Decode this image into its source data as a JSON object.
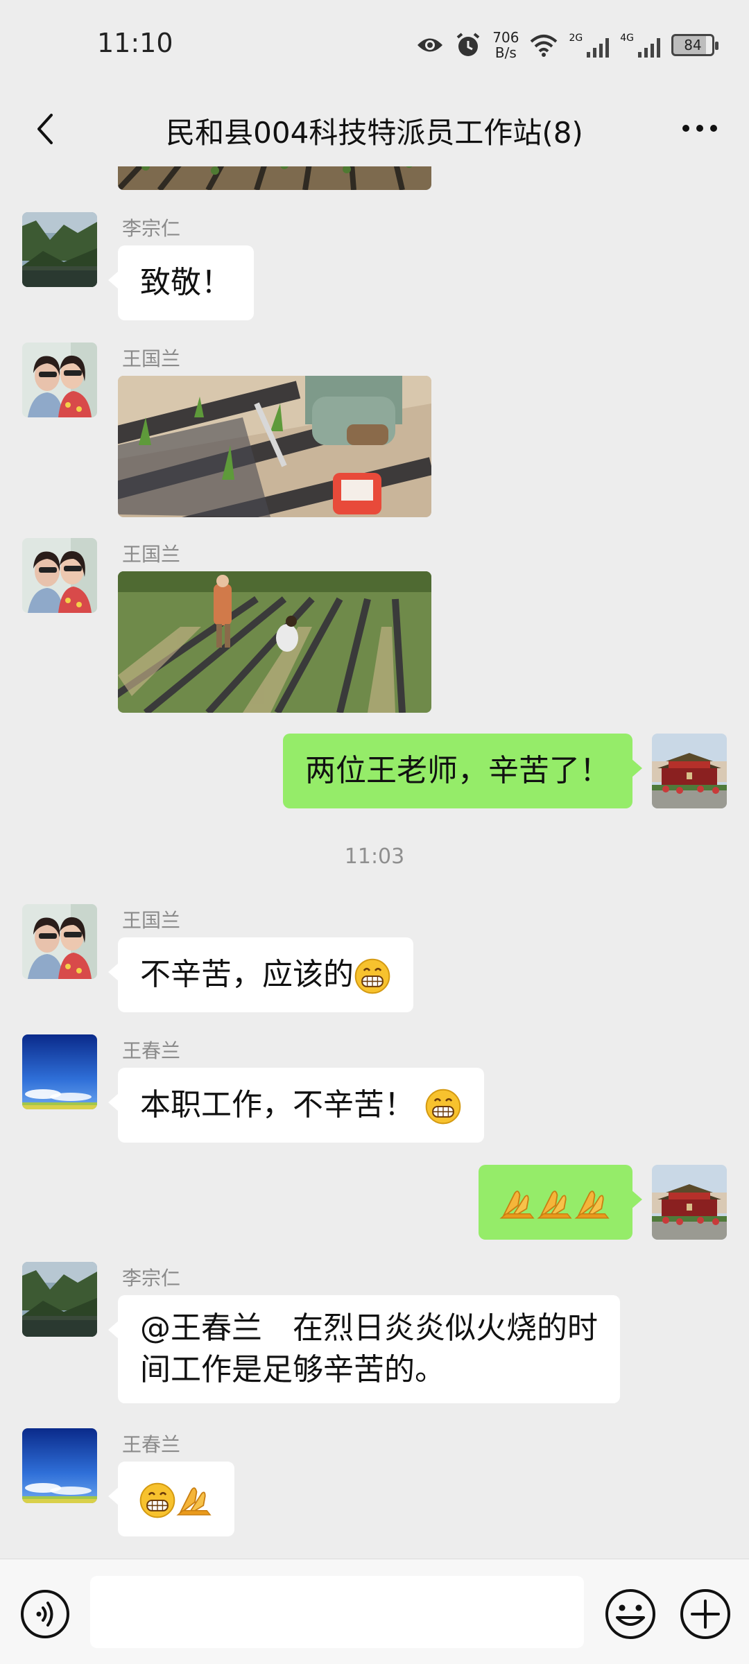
{
  "status_bar": {
    "time": "11:10",
    "net_speed_value": "706",
    "net_speed_unit": "B/s",
    "sim1_label": "2G",
    "sim2_label": "4G",
    "battery": "84",
    "icons": [
      "eye-icon",
      "alarm-icon",
      "wifi-icon",
      "signal-icon",
      "signal-icon",
      "battery-icon"
    ]
  },
  "header": {
    "title": "民和县004科技特派员工作站(8)",
    "back_icon": "chevron-left-icon",
    "more_icon": "more-dots-icon"
  },
  "messages": [
    {
      "type": "image",
      "direction": "in",
      "description_icon": "photo-field-rows"
    },
    {
      "type": "text",
      "direction": "in",
      "sender": "李宗仁",
      "avatar": "avatar-mountain-lake",
      "text": "致敬！"
    },
    {
      "type": "image",
      "direction": "in",
      "sender": "王国兰",
      "avatar": "avatar-two-women"
    },
    {
      "type": "image",
      "direction": "in",
      "sender": "王国兰",
      "avatar": "avatar-two-women"
    },
    {
      "type": "text",
      "direction": "out",
      "avatar": "avatar-tiananmen",
      "text": "两位王老师，辛苦了！"
    },
    {
      "type": "time",
      "text": "11:03"
    },
    {
      "type": "text",
      "direction": "in",
      "sender": "王国兰",
      "avatar": "avatar-two-women",
      "text": "不辛苦，应该的",
      "trailing_emoji": "grin-emoji"
    },
    {
      "type": "text",
      "direction": "in",
      "sender": "王春兰",
      "avatar": "avatar-blue-sky",
      "text": "本职工作，不辛苦！",
      "trailing_emoji": "grin-emoji"
    },
    {
      "type": "emoji",
      "direction": "out",
      "avatar": "avatar-tiananmen",
      "emojis": [
        "folded-hands-emoji",
        "folded-hands-emoji",
        "folded-hands-emoji"
      ]
    },
    {
      "type": "text",
      "direction": "in",
      "sender": "李宗仁",
      "avatar": "avatar-mountain-lake",
      "line1": "@王春兰　在烈日炎炎似火烧的时",
      "line2": "间工作是足够辛苦的。"
    },
    {
      "type": "emoji",
      "direction": "in",
      "sender": "王春兰",
      "avatar": "avatar-blue-sky",
      "emojis": [
        "grin-emoji",
        "folded-hands-emoji"
      ]
    }
  ],
  "input_bar": {
    "voice_icon": "voice-icon",
    "emoji_icon": "emoji-face-icon",
    "plus_icon": "plus-icon",
    "input_value": ""
  }
}
